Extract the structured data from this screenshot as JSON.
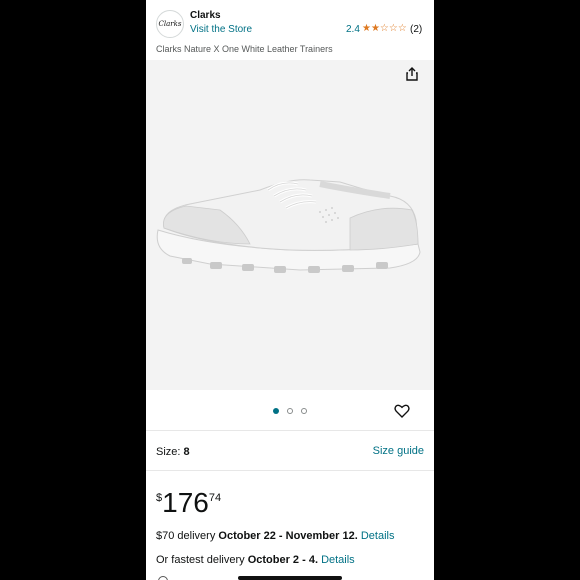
{
  "brand": {
    "logo_text": "Clarks",
    "name": "Clarks",
    "visit_link": "Visit the Store",
    "rating": "2.4",
    "stars": "★★☆☆☆",
    "rating_count": "(2)"
  },
  "product": {
    "title": "Clarks Nature X One White Leather Trainers"
  },
  "gallery": {
    "image_count": 3,
    "active_index": 0,
    "share_icon": "share-icon",
    "favorite_icon": "heart-icon"
  },
  "size": {
    "label": "Size:",
    "value": "8",
    "guide_link": "Size guide"
  },
  "price": {
    "currency": "$",
    "whole": "176",
    "fraction": "74"
  },
  "delivery": {
    "line1_prefix": "$70 delivery",
    "line1_dates": "October 22 - November 12.",
    "line1_link": "Details",
    "line2_prefix": "Or fastest delivery",
    "line2_dates": "October 2 - 4.",
    "line2_link": "Details"
  },
  "colors": {
    "link": "#007185",
    "star": "#de7921",
    "active_dot": "#007185",
    "background": "#000000"
  }
}
